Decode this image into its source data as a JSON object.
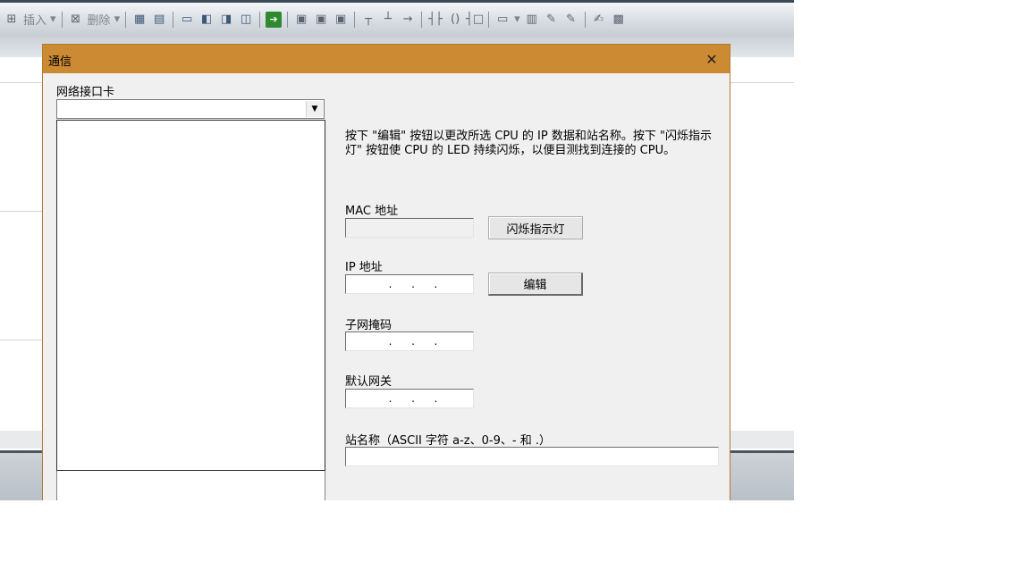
{
  "toolbar": {
    "insert_label": "插入",
    "delete_label": "删除"
  },
  "dialog": {
    "title": "通信",
    "network_interface": {
      "label": "网络接口卡",
      "selected_value": ""
    },
    "instructions": "按下 \"编辑\" 按钮以更改所选 CPU 的 IP 数据和站名称。按下 \"闪烁指示灯\" 按钮使 CPU 的 LED 持续闪烁，以便目测找到连接的 CPU。",
    "mac": {
      "label": "MAC 地址",
      "value": ""
    },
    "flash_button_label": "闪烁指示灯",
    "ip": {
      "label": "IP 地址",
      "placeholder": ". . ."
    },
    "edit_button_label": "编辑",
    "subnet": {
      "label": "子网掩码",
      "placeholder": ". . ."
    },
    "gateway": {
      "label": "默认网关",
      "placeholder": ". . ."
    },
    "station_name": {
      "label": "站名称（ASCII 字符 a-z、0-9、- 和 .）",
      "value": ""
    }
  },
  "colors": {
    "title_bar": "#cc8a33",
    "dialog_bg": "#f0f0f0"
  }
}
